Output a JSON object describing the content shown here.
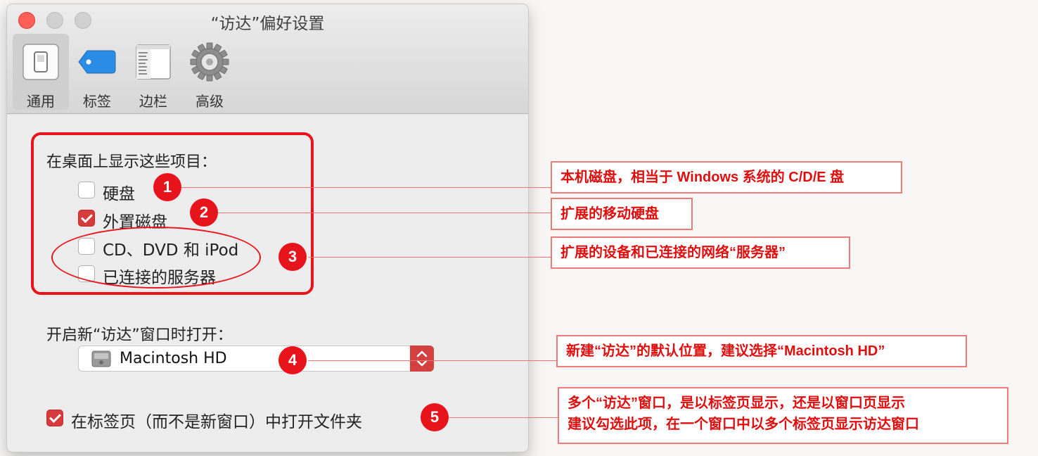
{
  "window": {
    "title": "“访达”偏好设置"
  },
  "toolbar": {
    "items": [
      {
        "label": "通用",
        "icon": "general-switch-icon"
      },
      {
        "label": "标签",
        "icon": "tag-icon"
      },
      {
        "label": "边栏",
        "icon": "sidebar-icon"
      },
      {
        "label": "高级",
        "icon": "gear-icon"
      }
    ],
    "active": "通用"
  },
  "desktop_section": {
    "label": "在桌面上显示这些项目：",
    "items": [
      {
        "label": "硬盘",
        "checked": false
      },
      {
        "label": "外置磁盘",
        "checked": true
      },
      {
        "label": "CD、DVD 和 iPod",
        "checked": false
      },
      {
        "label": "已连接的服务器",
        "checked": false
      }
    ]
  },
  "new_window": {
    "label": "开启新“访达”窗口时打开：",
    "selected": "Macintosh HD"
  },
  "tabs_option": {
    "label": "在标签页（而不是新窗口）中打开文件夹",
    "checked": true
  },
  "annotations": [
    {
      "number": "1",
      "text": "本机磁盘，相当于 Windows 系统的 C/D/E 盘"
    },
    {
      "number": "2",
      "text": "扩展的移动硬盘"
    },
    {
      "number": "3",
      "text": "扩展的设备和已连接的网络“服务器”"
    },
    {
      "number": "4",
      "text": "新建“访达”的默认位置，建议选择“Macintosh HD”"
    },
    {
      "number": "5",
      "text_line1": "多个“访达”窗口，是以标签页显示，还是以窗口页显示",
      "text_line2": "建议勾选此项，在一个窗口中以多个标签页显示访达窗口"
    }
  ],
  "colors": {
    "annotation_red": "#e8141c",
    "checkbox_red": "#d63a3a",
    "note_border": "#f07a7a"
  }
}
